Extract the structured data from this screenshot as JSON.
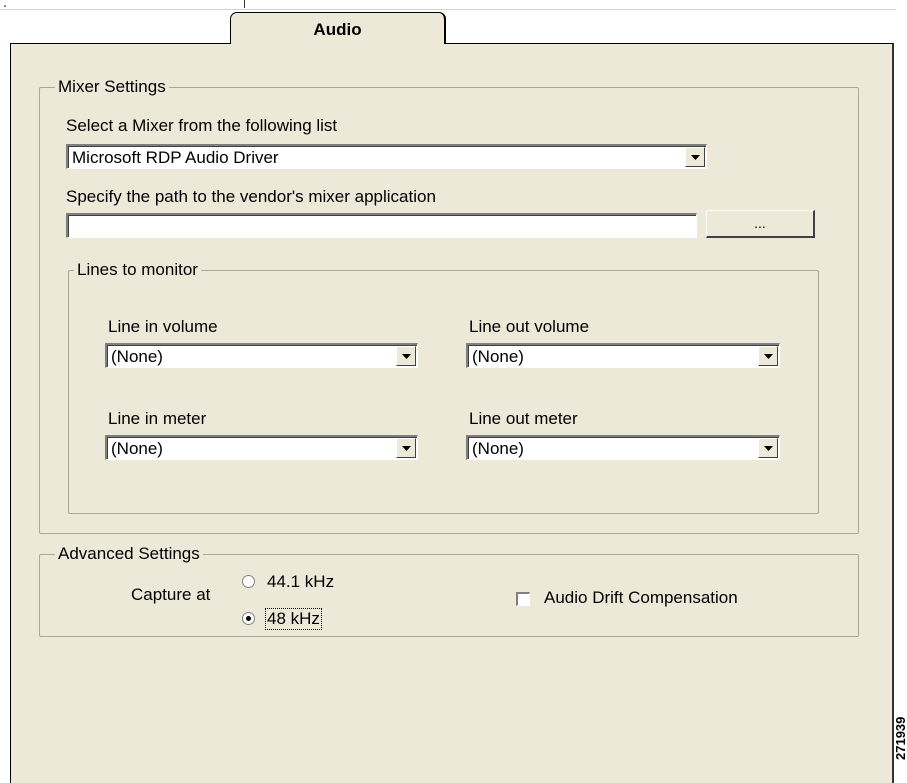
{
  "tab": {
    "label": "Audio"
  },
  "mixer_settings": {
    "legend": "Mixer Settings",
    "select_mixer_label": "Select a Mixer from the following list",
    "mixer_value": "Microsoft RDP Audio Driver",
    "path_label": "Specify the path to the vendor's mixer application",
    "path_value": "",
    "browse_label": "...",
    "lines": {
      "legend": "Lines to monitor",
      "line_in_volume_label": "Line in volume",
      "line_in_volume_value": "(None)",
      "line_out_volume_label": "Line out volume",
      "line_out_volume_value": "(None)",
      "line_in_meter_label": "Line in meter",
      "line_in_meter_value": "(None)",
      "line_out_meter_label": "Line out meter",
      "line_out_meter_value": "(None)"
    }
  },
  "advanced_settings": {
    "legend": "Advanced Settings",
    "capture_label": "Capture at",
    "rate_options": [
      {
        "label": "44.1 kHz",
        "selected": false
      },
      {
        "label": "48 kHz",
        "selected": true
      }
    ],
    "drift_label": "Audio Drift Compensation",
    "drift_checked": false
  },
  "figure_id": "271939"
}
